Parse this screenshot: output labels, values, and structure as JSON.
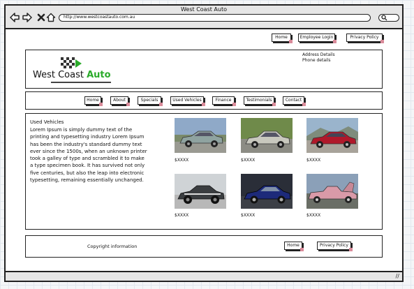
{
  "window": {
    "title": "West Coast Auto",
    "url": "http://www.westcoastauto.com.au"
  },
  "top_links": [
    {
      "label": "Home"
    },
    {
      "label": "Employee Login"
    },
    {
      "label": "Privacy Policy"
    }
  ],
  "header": {
    "logo_main": "West Coast ",
    "logo_accent": "Auto",
    "address": "Address Details",
    "phone": "Phone details"
  },
  "nav": [
    {
      "label": "Home"
    },
    {
      "label": "About"
    },
    {
      "label": "Specials"
    },
    {
      "label": "Used Vehicles"
    },
    {
      "label": "Finance"
    },
    {
      "label": "Testimonials"
    },
    {
      "label": "Contact"
    }
  ],
  "content": {
    "title": "Used Vehicles",
    "body": "Lorem Ipsum is simply dummy text of the printing and typesetting industry Lorem Ipsum has been the industry's standard dummy text ever since the 1500s, when an unknown printer took a galley of type and scrambled it to make a type specimen book. It has survived not only five centuries, but also the leap into electronic typesetting, remaining essentially unchanged."
  },
  "vehicles": [
    {
      "price": "$XXXX",
      "color": "#8fa3a0"
    },
    {
      "price": "$XXXX",
      "color": "#c8c8be"
    },
    {
      "price": "$XXXX",
      "color": "#b0182a"
    },
    {
      "price": "$XXXX",
      "color": "#3a3d40"
    },
    {
      "price": "$XXXX",
      "color": "#1d2a7a"
    },
    {
      "price": "$XXXX",
      "color": "#d99aa8"
    }
  ],
  "footer": {
    "copyright": "Copyright information",
    "links": [
      {
        "label": "Home"
      },
      {
        "label": "Privacy Policy"
      }
    ]
  },
  "colors": {
    "logo_accent": "#2bab2b",
    "button_corner": "#d98b9a",
    "chrome": "#e6e6e6"
  }
}
